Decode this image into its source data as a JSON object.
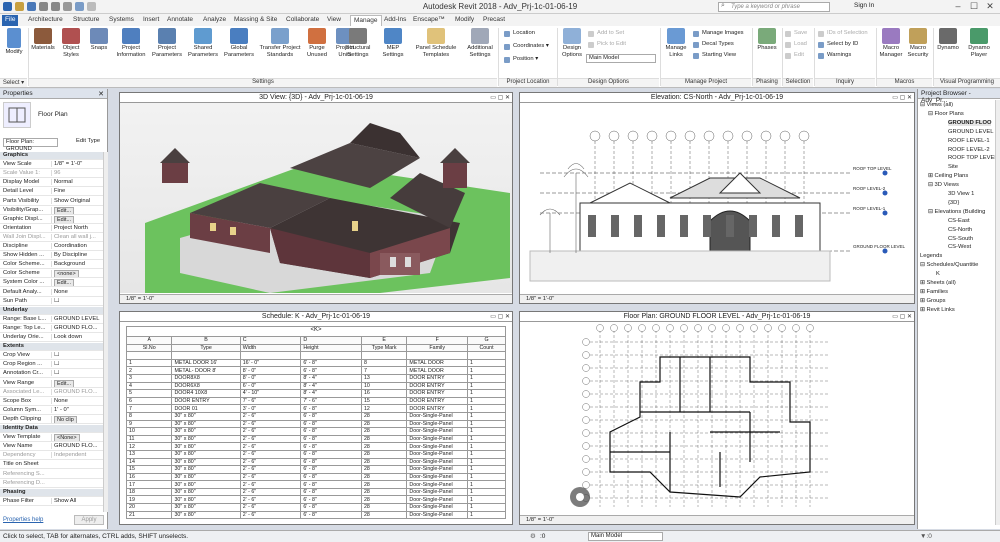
{
  "title": "Autodesk Revit 2018 -  Adv_Prj-1c-01-06-19",
  "search_placeholder": "Type a keyword or phrase",
  "sign_in": "Sign In",
  "tabs": [
    "File",
    "Architecture",
    "Structure",
    "Systems",
    "Insert",
    "Annotate",
    "Analyze",
    "Massing & Site",
    "Collaborate",
    "View",
    "Manage",
    "Add-Ins",
    "Enscape™",
    "Modify",
    "Precast"
  ],
  "active_tab": "Manage",
  "ribbon": {
    "modify": "Modify",
    "select": "Select ▾",
    "settings_buttons": [
      "Materials",
      "Object Styles",
      "Snaps",
      "Project Information",
      "Project Parameters",
      "Shared Parameters",
      "Global Parameters",
      "Transfer Project Standards",
      "Purge Unused",
      "Project Units"
    ],
    "structural_settings": "Structural Settings",
    "mep_settings": "MEP Settings",
    "panel_schedule": "Panel Schedule Templates",
    "additional_settings": "Additional Settings",
    "location": "Location",
    "coordinates": "Coordinates ▾",
    "position": "Position ▾",
    "design_options": "Design Options",
    "add_to_set": "Add to Set",
    "pick_to_edit": "Pick to Edit",
    "main_model": "Main Model",
    "manage_links": "Manage Links",
    "manage_images": "Manage Images",
    "decal_types": "Decal Types",
    "starting_view": "Starting View",
    "phases": "Phases",
    "save": "Save",
    "load": "Load",
    "edit": "Edit",
    "ids_of_selection": "IDs of Selection",
    "select_by_id": "Select by ID",
    "warnings": "Warnings",
    "macro_manager": "Macro Manager",
    "macro_security": "Macro Security",
    "dynamo": "Dynamo",
    "dynamo_player": "Dynamo Player",
    "panels": [
      "Settings",
      "Project Location",
      "Design Options",
      "Manage Project",
      "Phasing",
      "Selection",
      "Inquiry",
      "Macros",
      "Visual Programming"
    ]
  },
  "properties": {
    "header": "Properties",
    "type_name": "Floor Plan",
    "instance_selector": "Floor Plan: GROUND",
    "edit_type": "Edit Type",
    "rows": [
      {
        "k": "Graphics",
        "v": "",
        "g": true
      },
      {
        "k": "View Scale",
        "v": "1/8\" = 1'-0\""
      },
      {
        "k": "Scale Value  1:",
        "v": "96",
        "d": true
      },
      {
        "k": "Display Model",
        "v": "Normal"
      },
      {
        "k": "Detail Level",
        "v": "Fine"
      },
      {
        "k": "Parts Visibility",
        "v": "Show Original"
      },
      {
        "k": "Visibility/Grap...",
        "v": "Edit...",
        "b": true
      },
      {
        "k": "Graphic Displ...",
        "v": "Edit...",
        "b": true
      },
      {
        "k": "Orientation",
        "v": "Project North"
      },
      {
        "k": "Wall Join Displ...",
        "v": "Clean all wall j...",
        "d": true
      },
      {
        "k": "Discipline",
        "v": "Coordination"
      },
      {
        "k": "Show Hidden ...",
        "v": "By Discipline"
      },
      {
        "k": "Color Scheme...",
        "v": "Background"
      },
      {
        "k": "Color Scheme",
        "v": "<none>",
        "b": true
      },
      {
        "k": "System Color ...",
        "v": "Edit...",
        "b": true
      },
      {
        "k": "Default Analy...",
        "v": "None"
      },
      {
        "k": "Sun Path",
        "v": "☐"
      },
      {
        "k": "Underlay",
        "v": "",
        "g": true
      },
      {
        "k": "Range: Base L...",
        "v": "GROUND LEVEL"
      },
      {
        "k": "Range: Top Le...",
        "v": "GROUND FLO..."
      },
      {
        "k": "Underlay Orie...",
        "v": "Look down"
      },
      {
        "k": "Extents",
        "v": "",
        "g": true
      },
      {
        "k": "Crop View",
        "v": "☐"
      },
      {
        "k": "Crop Region ...",
        "v": "☐"
      },
      {
        "k": "Annotation Cr...",
        "v": "☐"
      },
      {
        "k": "View Range",
        "v": "Edit...",
        "b": true
      },
      {
        "k": "Associated Le...",
        "v": "GROUND FLO...",
        "d": true
      },
      {
        "k": "Scope Box",
        "v": "None"
      },
      {
        "k": "Column Sym...",
        "v": "1' - 0\""
      },
      {
        "k": "Depth Clipping",
        "v": "No clip",
        "b": true
      },
      {
        "k": "Identity Data",
        "v": "",
        "g": true
      },
      {
        "k": "View Template",
        "v": "<None>",
        "b": true
      },
      {
        "k": "View Name",
        "v": "GROUND FLO..."
      },
      {
        "k": "Dependency",
        "v": "Independent",
        "d": true
      },
      {
        "k": "Title on Sheet",
        "v": ""
      },
      {
        "k": "Referencing S...",
        "v": "",
        "d": true
      },
      {
        "k": "Referencing D...",
        "v": "",
        "d": true
      },
      {
        "k": "Phasing",
        "v": "",
        "g": true
      },
      {
        "k": "Phase Filter",
        "v": "Show All"
      }
    ],
    "help": "Properties help",
    "apply": "Apply"
  },
  "views": {
    "v3d": {
      "title": "3D View: {3D} - Adv_Prj-1c-01-06-19",
      "scale": "1/8\" = 1'-0\""
    },
    "elev": {
      "title": "Elevation: CS-North - Adv_Prj-1c-01-06-19",
      "scale": "1/8\" = 1'-0\""
    },
    "sched": {
      "title": "Schedule: K - Adv_Prj-1c-01-06-19"
    },
    "plan": {
      "title": "Floor Plan: GROUND FLOOR LEVEL - Adv_Prj-1c-01-06-19",
      "scale": "1/8\" = 1'-0\""
    }
  },
  "elevation_levels": [
    "ROOF TOP LEVEL",
    "ROOF LEVEL-2",
    "ROOF LEVEL-1",
    "GROUND FLOOR LEVEL"
  ],
  "schedule": {
    "name": "<K>",
    "letters": [
      "A",
      "B",
      "C",
      "D",
      "E",
      "F",
      "G"
    ],
    "headers": [
      "Sl.No",
      "Type",
      "Width",
      "Height",
      "Type Mark",
      "Family",
      "Count"
    ],
    "rows": [
      [
        "1",
        "METAL DOOR 16'",
        "16' - 0\"",
        "6' - 8\"",
        "8",
        "METAL DOOR",
        "1"
      ],
      [
        "2",
        "METAL- DOOR 8'",
        "8' - 0\"",
        "6' - 8\"",
        "7",
        "METAL DOOR",
        "1"
      ],
      [
        "3",
        "DOOR8X8",
        "8' - 0\"",
        "8' - 4\"",
        "13",
        "DOOR ENTRY",
        "1"
      ],
      [
        "4",
        "DOOR6X8",
        "6' - 0\"",
        "8' - 4\"",
        "10",
        "DOOR ENTRY",
        "1"
      ],
      [
        "5",
        "DOOR4 10X8",
        "4' - 10\"",
        "8' - 4\"",
        "16",
        "DOOR ENTRY",
        "1"
      ],
      [
        "6",
        "DOOR ENTRY",
        "7' - 6\"",
        "7' - 6\"",
        "15",
        "DOOR ENTRY",
        "1"
      ],
      [
        "7",
        "DOOR 01",
        "3' - 0\"",
        "6' - 8\"",
        "12",
        "DOOR ENTRY",
        "1"
      ],
      [
        "8",
        "30\" x 80\"",
        "2' - 6\"",
        "6' - 8\"",
        "28",
        "Door-Single-Panel",
        "1"
      ],
      [
        "9",
        "30\" x 80\"",
        "2' - 6\"",
        "6' - 8\"",
        "28",
        "Door-Single-Panel",
        "1"
      ],
      [
        "10",
        "30\" x 80\"",
        "2' - 6\"",
        "6' - 8\"",
        "28",
        "Door-Single-Panel",
        "1"
      ],
      [
        "11",
        "30\" x 80\"",
        "2' - 6\"",
        "6' - 8\"",
        "28",
        "Door-Single-Panel",
        "1"
      ],
      [
        "12",
        "30\" x 80\"",
        "2' - 6\"",
        "6' - 8\"",
        "28",
        "Door-Single-Panel",
        "1"
      ],
      [
        "13",
        "30\" x 80\"",
        "2' - 6\"",
        "6' - 8\"",
        "28",
        "Door-Single-Panel",
        "1"
      ],
      [
        "14",
        "30\" x 80\"",
        "2' - 6\"",
        "6' - 8\"",
        "28",
        "Door-Single-Panel",
        "1"
      ],
      [
        "15",
        "30\" x 80\"",
        "2' - 6\"",
        "6' - 8\"",
        "28",
        "Door-Single-Panel",
        "1"
      ],
      [
        "16",
        "30\" x 80\"",
        "2' - 6\"",
        "6' - 8\"",
        "28",
        "Door-Single-Panel",
        "1"
      ],
      [
        "17",
        "30\" x 80\"",
        "2' - 6\"",
        "6' - 8\"",
        "28",
        "Door-Single-Panel",
        "1"
      ],
      [
        "18",
        "30\" x 80\"",
        "2' - 6\"",
        "6' - 8\"",
        "28",
        "Door-Single-Panel",
        "1"
      ],
      [
        "19",
        "30\" x 80\"",
        "2' - 6\"",
        "6' - 8\"",
        "28",
        "Door-Single-Panel",
        "1"
      ],
      [
        "20",
        "30\" x 80\"",
        "2' - 6\"",
        "6' - 8\"",
        "28",
        "Door-Single-Panel",
        "1"
      ],
      [
        "21",
        "30\" x 80\"",
        "2' - 6\"",
        "6' - 8\"",
        "28",
        "Door-Single-Panel",
        "1"
      ]
    ]
  },
  "browser": {
    "header": "Project Browser - Adv_Pr...",
    "items": [
      {
        "t": "⊟ Views (all)",
        "x": 2
      },
      {
        "t": "⊟ Floor Plans",
        "x": 10
      },
      {
        "t": "GROUND FLOO",
        "x": 30,
        "sel": true
      },
      {
        "t": "GROUND LEVEL",
        "x": 30
      },
      {
        "t": "ROOF LEVEL-1",
        "x": 30
      },
      {
        "t": "ROOF LEVEL-2",
        "x": 30
      },
      {
        "t": "ROOF TOP LEVEL",
        "x": 30
      },
      {
        "t": "Site",
        "x": 30
      },
      {
        "t": "⊞ Ceiling Plans",
        "x": 10
      },
      {
        "t": "⊟ 3D Views",
        "x": 10
      },
      {
        "t": "3D View 1",
        "x": 30
      },
      {
        "t": "{3D}",
        "x": 30
      },
      {
        "t": "⊟ Elevations (Building",
        "x": 10
      },
      {
        "t": "CS-East",
        "x": 30
      },
      {
        "t": "CS-North",
        "x": 30
      },
      {
        "t": "CS-South",
        "x": 30
      },
      {
        "t": "CS-West",
        "x": 30
      },
      {
        "t": "Legends",
        "x": 2
      },
      {
        "t": "⊟ Schedules/Quantitie",
        "x": 2
      },
      {
        "t": "K",
        "x": 18
      },
      {
        "t": "⊞ Sheets (all)",
        "x": 2
      },
      {
        "t": "⊞ Families",
        "x": 2
      },
      {
        "t": "⊞ Groups",
        "x": 2
      },
      {
        "t": "⊞ Revit Links",
        "x": 2
      }
    ]
  },
  "status": {
    "hint": "Click to select, TAB for alternates, CTRL adds, SHIFT unselects.",
    "zoom": ":0",
    "model": "Main Model"
  }
}
